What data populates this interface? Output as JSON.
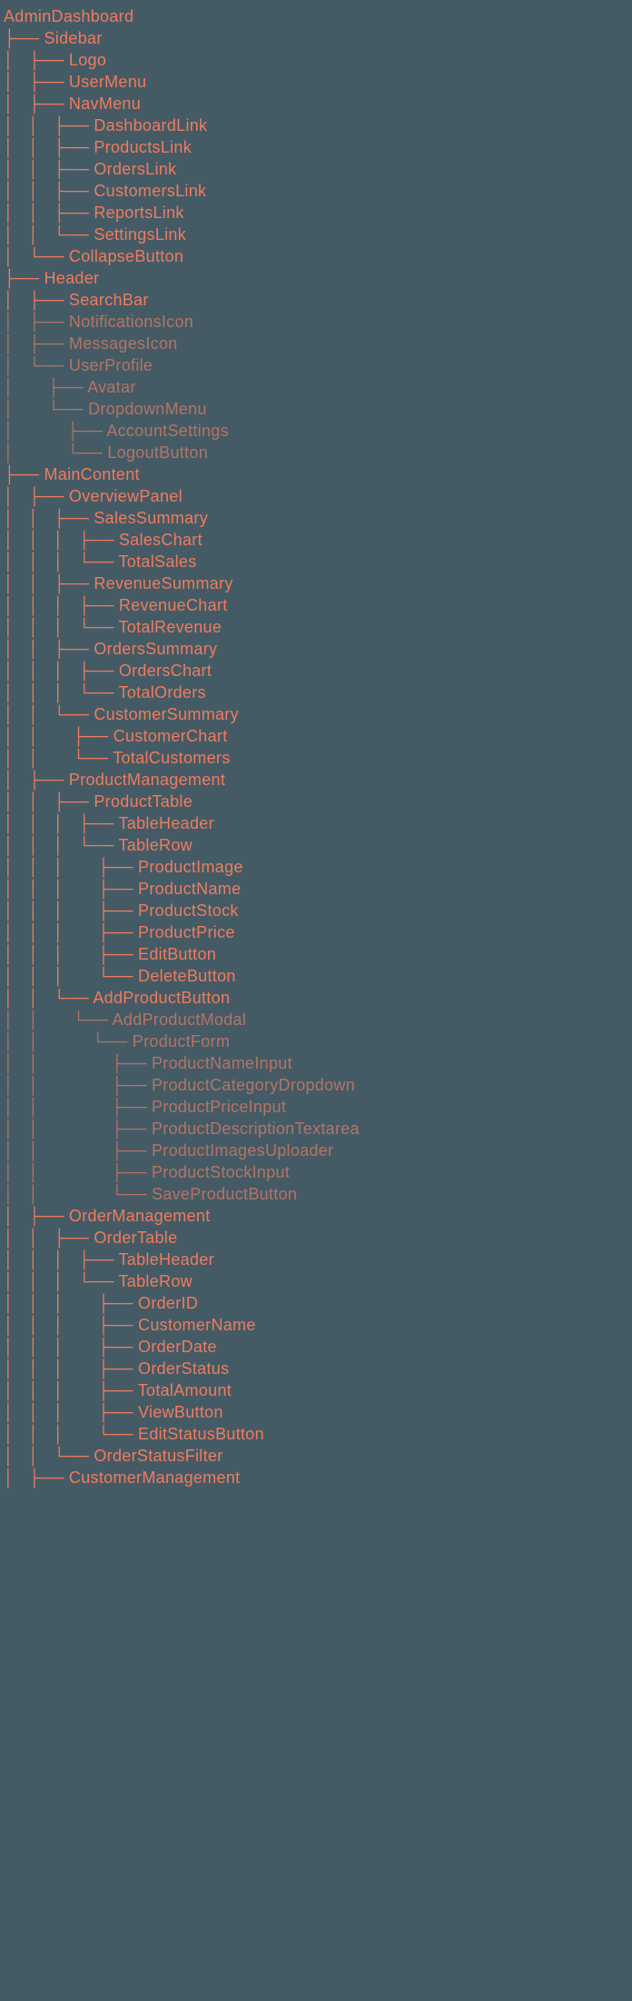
{
  "tree": [
    {
      "prefix": "",
      "label": "AdminDashboard",
      "faded": false
    },
    {
      "prefix": "├── ",
      "label": "Sidebar",
      "faded": false
    },
    {
      "prefix": "│   ├── ",
      "label": "Logo",
      "faded": false
    },
    {
      "prefix": "│   ├── ",
      "label": "UserMenu",
      "faded": false
    },
    {
      "prefix": "│   ├── ",
      "label": "NavMenu",
      "faded": false
    },
    {
      "prefix": "│   │   ├── ",
      "label": "DashboardLink",
      "faded": false
    },
    {
      "prefix": "│   │   ├── ",
      "label": "ProductsLink",
      "faded": false
    },
    {
      "prefix": "│   │   ├── ",
      "label": "OrdersLink",
      "faded": false
    },
    {
      "prefix": "│   │   ├── ",
      "label": "CustomersLink",
      "faded": false
    },
    {
      "prefix": "│   │   ├── ",
      "label": "ReportsLink",
      "faded": false
    },
    {
      "prefix": "│   │   └── ",
      "label": "SettingsLink",
      "faded": false
    },
    {
      "prefix": "│   └── ",
      "label": "CollapseButton",
      "faded": false
    },
    {
      "prefix": "├── ",
      "label": "Header",
      "faded": false
    },
    {
      "prefix": "│   ├── ",
      "label": "SearchBar",
      "faded": false
    },
    {
      "prefix": "│   ├── ",
      "label": "NotificationsIcon",
      "faded": true
    },
    {
      "prefix": "│   ├── ",
      "label": "MessagesIcon",
      "faded": true
    },
    {
      "prefix": "│   └── ",
      "label": "UserProfile",
      "faded": true
    },
    {
      "prefix": "│       ├── ",
      "label": "Avatar",
      "faded": true
    },
    {
      "prefix": "│       └── ",
      "label": "DropdownMenu",
      "faded": true
    },
    {
      "prefix": "│           ├── ",
      "label": "AccountSettings",
      "faded": true
    },
    {
      "prefix": "│           └── ",
      "label": "LogoutButton",
      "faded": true
    },
    {
      "prefix": "├── ",
      "label": "MainContent",
      "faded": false
    },
    {
      "prefix": "│   ├── ",
      "label": "OverviewPanel",
      "faded": false
    },
    {
      "prefix": "│   │   ├── ",
      "label": "SalesSummary",
      "faded": false
    },
    {
      "prefix": "│   │   │   ├── ",
      "label": "SalesChart",
      "faded": false
    },
    {
      "prefix": "│   │   │   └── ",
      "label": "TotalSales",
      "faded": false
    },
    {
      "prefix": "│   │   ├── ",
      "label": "RevenueSummary",
      "faded": false
    },
    {
      "prefix": "│   │   │   ├── ",
      "label": "RevenueChart",
      "faded": false
    },
    {
      "prefix": "│   │   │   └── ",
      "label": "TotalRevenue",
      "faded": false
    },
    {
      "prefix": "│   │   ├── ",
      "label": "OrdersSummary",
      "faded": false
    },
    {
      "prefix": "│   │   │   ├── ",
      "label": "OrdersChart",
      "faded": false
    },
    {
      "prefix": "│   │   │   └── ",
      "label": "TotalOrders",
      "faded": false
    },
    {
      "prefix": "│   │   └── ",
      "label": "CustomerSummary",
      "faded": false
    },
    {
      "prefix": "│   │       ├── ",
      "label": "CustomerChart",
      "faded": false
    },
    {
      "prefix": "│   │       └── ",
      "label": "TotalCustomers",
      "faded": false
    },
    {
      "prefix": "│   ├── ",
      "label": "ProductManagement",
      "faded": false
    },
    {
      "prefix": "│   │   ├── ",
      "label": "ProductTable",
      "faded": false
    },
    {
      "prefix": "│   │   │   ├── ",
      "label": "TableHeader",
      "faded": false
    },
    {
      "prefix": "│   │   │   └── ",
      "label": "TableRow",
      "faded": false
    },
    {
      "prefix": "│   │   │       ├── ",
      "label": "ProductImage",
      "faded": false
    },
    {
      "prefix": "│   │   │       ├── ",
      "label": "ProductName",
      "faded": false
    },
    {
      "prefix": "│   │   │       ├── ",
      "label": "ProductStock",
      "faded": false
    },
    {
      "prefix": "│   │   │       ├── ",
      "label": "ProductPrice",
      "faded": false
    },
    {
      "prefix": "│   │   │       ├── ",
      "label": "EditButton",
      "faded": false
    },
    {
      "prefix": "│   │   │       └── ",
      "label": "DeleteButton",
      "faded": false
    },
    {
      "prefix": "│   │   └── ",
      "label": "AddProductButton",
      "faded": false
    },
    {
      "prefix": "│   │       └── ",
      "label": "AddProductModal",
      "faded": true
    },
    {
      "prefix": "│   │           └── ",
      "label": "ProductForm",
      "faded": true
    },
    {
      "prefix": "│   │               ├── ",
      "label": "ProductNameInput",
      "faded": true
    },
    {
      "prefix": "│   │               ├── ",
      "label": "ProductCategoryDropdown",
      "faded": true
    },
    {
      "prefix": "│   │               ├── ",
      "label": "ProductPriceInput",
      "faded": true
    },
    {
      "prefix": "│   │               ├── ",
      "label": "ProductDescriptionTextarea",
      "faded": true
    },
    {
      "prefix": "│   │               ├── ",
      "label": "ProductImagesUploader",
      "faded": true
    },
    {
      "prefix": "│   │               ├── ",
      "label": "ProductStockInput",
      "faded": true
    },
    {
      "prefix": "│   │               └── ",
      "label": "SaveProductButton",
      "faded": true
    },
    {
      "prefix": "│   ├── ",
      "label": "OrderManagement",
      "faded": false
    },
    {
      "prefix": "│   │   ├── ",
      "label": "OrderTable",
      "faded": false
    },
    {
      "prefix": "│   │   │   ├── ",
      "label": "TableHeader",
      "faded": false
    },
    {
      "prefix": "│   │   │   └── ",
      "label": "TableRow",
      "faded": false
    },
    {
      "prefix": "│   │   │       ├── ",
      "label": "OrderID",
      "faded": false
    },
    {
      "prefix": "│   │   │       ├── ",
      "label": "CustomerName",
      "faded": false
    },
    {
      "prefix": "│   │   │       ├── ",
      "label": "OrderDate",
      "faded": false
    },
    {
      "prefix": "│   │   │       ├── ",
      "label": "OrderStatus",
      "faded": false
    },
    {
      "prefix": "│   │   │       ├── ",
      "label": "TotalAmount",
      "faded": false
    },
    {
      "prefix": "│   │   │       ├── ",
      "label": "ViewButton",
      "faded": false
    },
    {
      "prefix": "│   │   │       └── ",
      "label": "EditStatusButton",
      "faded": false
    },
    {
      "prefix": "│   │   └── ",
      "label": "OrderStatusFilter",
      "faded": false
    },
    {
      "prefix": "│   ├── ",
      "label": "CustomerManagement",
      "faded": false
    }
  ]
}
